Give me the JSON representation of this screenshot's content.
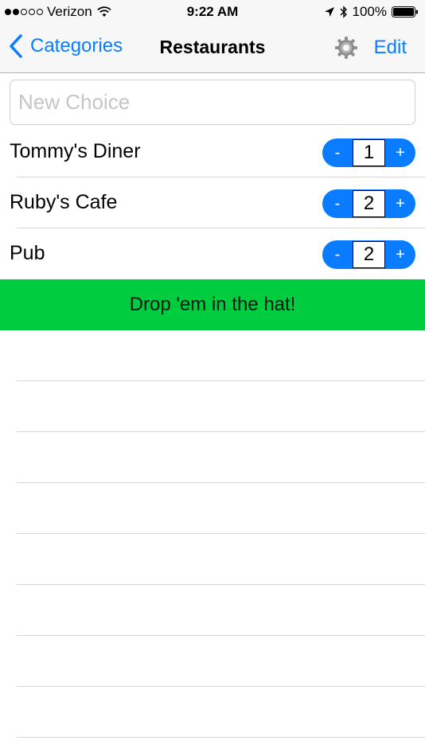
{
  "status_bar": {
    "carrier": "Verizon",
    "time": "9:22 AM",
    "battery": "100%",
    "signal_filled": 2,
    "signal_total": 5
  },
  "nav": {
    "back_label": "Categories",
    "title": "Restaurants",
    "edit_label": "Edit"
  },
  "new_choice": {
    "placeholder": "New Choice",
    "value": ""
  },
  "choices": [
    {
      "name": "Tommy's Diner",
      "count": "1",
      "minus": "-",
      "plus": "+"
    },
    {
      "name": "Ruby's Cafe",
      "count": "2",
      "minus": "-",
      "plus": "+"
    },
    {
      "name": "Pub",
      "count": "2",
      "minus": "-",
      "plus": "+"
    }
  ],
  "action": {
    "label": "Drop 'em in the hat!"
  },
  "colors": {
    "accent": "#0a7cff",
    "action_green": "#00cc3f"
  }
}
